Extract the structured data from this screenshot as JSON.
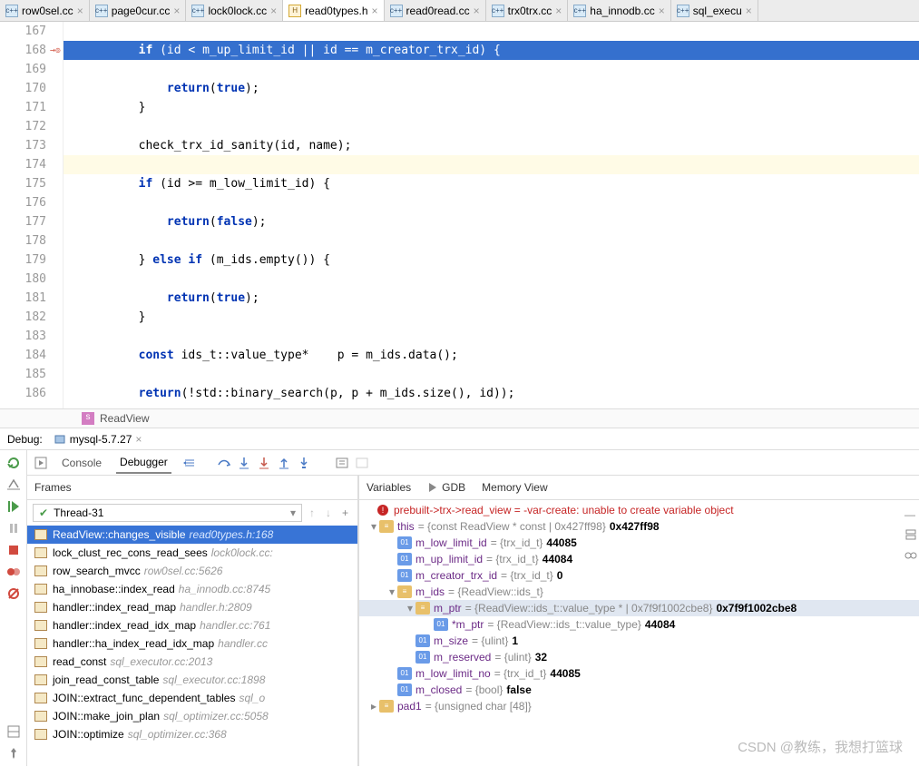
{
  "tabs": [
    {
      "label": "row0sel.cc"
    },
    {
      "label": "page0cur.cc"
    },
    {
      "label": "lock0lock.cc"
    },
    {
      "label": "read0types.h",
      "active": true,
      "h": true
    },
    {
      "label": "read0read.cc"
    },
    {
      "label": "trx0trx.cc"
    },
    {
      "label": "ha_innodb.cc"
    },
    {
      "label": "sql_execu"
    }
  ],
  "lines": {
    "167": "",
    "168": "        if (id < m_up_limit_id || id == m_creator_trx_id) {",
    "169": "",
    "170": "            return(true);",
    "171": "        }",
    "172": "",
    "173": "        check_trx_id_sanity(id, name);",
    "174": "",
    "175": "        if (id >= m_low_limit_id) {",
    "176": "",
    "177": "            return(false);",
    "178": "",
    "179": "        } else if (m_ids.empty()) {",
    "180": "",
    "181": "            return(true);",
    "182": "        }",
    "183": "",
    "184": "        const ids_t::value_type*    p = m_ids.data();",
    "185": "",
    "186": "        return(!std::binary_search(p, p + m_ids.size(), id));"
  },
  "currentLine": "168",
  "highlightLine": "174",
  "breadcrumb": {
    "class": "ReadView"
  },
  "debug": {
    "label": "Debug:",
    "config": "mysql-5.7.27"
  },
  "toolTabs": {
    "console": "Console",
    "debugger": "Debugger"
  },
  "framesPanel": {
    "title": "Frames",
    "thread": "Thread-31"
  },
  "frames": [
    {
      "fn": "ReadView::changes_visible",
      "loc": "read0types.h:168",
      "sel": true
    },
    {
      "fn": "lock_clust_rec_cons_read_sees",
      "loc": "lock0lock.cc:"
    },
    {
      "fn": "row_search_mvcc",
      "loc": "row0sel.cc:5626"
    },
    {
      "fn": "ha_innobase::index_read",
      "loc": "ha_innodb.cc:8745"
    },
    {
      "fn": "handler::index_read_map",
      "loc": "handler.h:2809"
    },
    {
      "fn": "handler::index_read_idx_map",
      "loc": "handler.cc:761"
    },
    {
      "fn": "handler::ha_index_read_idx_map",
      "loc": "handler.cc"
    },
    {
      "fn": "read_const",
      "loc": "sql_executor.cc:2013"
    },
    {
      "fn": "join_read_const_table",
      "loc": "sql_executor.cc:1898"
    },
    {
      "fn": "JOIN::extract_func_dependent_tables",
      "loc": "sql_o"
    },
    {
      "fn": "JOIN::make_join_plan",
      "loc": "sql_optimizer.cc:5058"
    },
    {
      "fn": "JOIN::optimize",
      "loc": "sql_optimizer.cc:368"
    }
  ],
  "varsPanel": {
    "title": "Variables",
    "gdb": "GDB",
    "mem": "Memory View"
  },
  "error": {
    "expr": "prebuilt->trx->read_view",
    "msg": "-var-create: unable to create variable object"
  },
  "vars": [
    {
      "d": 0,
      "a": "v",
      "b": "obj",
      "n": "this",
      "t": "= {const ReadView * const | 0x427ff98}",
      "v": "0x427ff98"
    },
    {
      "d": 1,
      "a": "",
      "b": "prim",
      "n": "m_low_limit_id",
      "t": "= {trx_id_t}",
      "v": "44085"
    },
    {
      "d": 1,
      "a": "",
      "b": "prim",
      "n": "m_up_limit_id",
      "t": "= {trx_id_t}",
      "v": "44084"
    },
    {
      "d": 1,
      "a": "",
      "b": "prim",
      "n": "m_creator_trx_id",
      "t": "= {trx_id_t}",
      "v": "0"
    },
    {
      "d": 1,
      "a": "v",
      "b": "obj",
      "n": "m_ids",
      "t": "= {ReadView::ids_t}",
      "v": ""
    },
    {
      "d": 2,
      "a": "v",
      "b": "obj",
      "n": "m_ptr",
      "t": "= {ReadView::ids_t::value_type * | 0x7f9f1002cbe8}",
      "v": "0x7f9f1002cbe8",
      "sel": true
    },
    {
      "d": 3,
      "a": "",
      "b": "prim",
      "n": "*m_ptr",
      "t": "= {ReadView::ids_t::value_type}",
      "v": "44084"
    },
    {
      "d": 2,
      "a": "",
      "b": "prim",
      "n": "m_size",
      "t": "= {ulint}",
      "v": "1"
    },
    {
      "d": 2,
      "a": "",
      "b": "prim",
      "n": "m_reserved",
      "t": "= {ulint}",
      "v": "32"
    },
    {
      "d": 1,
      "a": "",
      "b": "prim",
      "n": "m_low_limit_no",
      "t": "= {trx_id_t}",
      "v": "44085"
    },
    {
      "d": 1,
      "a": "",
      "b": "prim",
      "n": "m_closed",
      "t": "= {bool}",
      "v": "false"
    },
    {
      "d": 0,
      "a": ">",
      "b": "obj",
      "n": "pad1",
      "t": "= {unsigned char [48]}",
      "v": ""
    }
  ],
  "watermark": "CSDN @教练，我想打篮球"
}
